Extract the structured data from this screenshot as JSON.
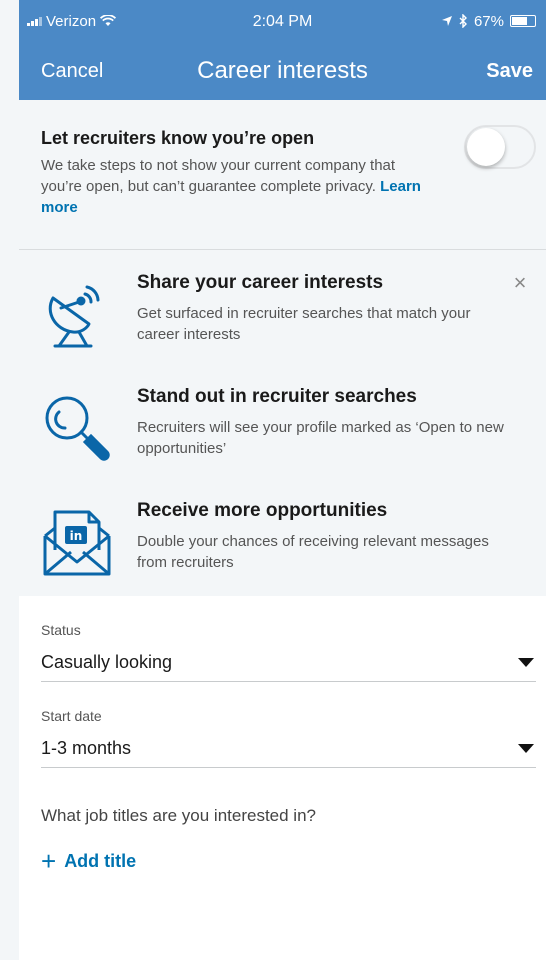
{
  "status_bar": {
    "carrier": "Verizon",
    "time": "2:04 PM",
    "battery": "67%"
  },
  "nav": {
    "cancel_label": "Cancel",
    "title": "Career interests",
    "save_label": "Save"
  },
  "open_to_recruiters": {
    "title": "Let recruiters know you’re open",
    "description": "We take steps to not show your current company that you’re open, but can’t guarantee complete privacy.",
    "learn_more": "Learn more",
    "toggle_on": false
  },
  "benefits": {
    "dismiss_label": "×",
    "items": [
      {
        "icon": "satellite-dish-icon",
        "title": "Share your career interests",
        "description": "Get surfaced in recruiter searches that match your career interests"
      },
      {
        "icon": "magnifier-icon",
        "title": "Stand out in recruiter searches",
        "description": "Recruiters will see your profile marked as ‘Open to new opportunities’"
      },
      {
        "icon": "linkedin-envelope-icon",
        "title": "Receive more opportunities",
        "description": "Double your chances of receiving relevant messages from recruiters"
      }
    ]
  },
  "form": {
    "status": {
      "label": "Status",
      "value": "Casually looking"
    },
    "start_date": {
      "label": "Start date",
      "value": "1-3 months"
    },
    "job_titles": {
      "question": "What job titles are you interested in?",
      "add_label": "Add title",
      "add_icon": "+"
    }
  },
  "colors": {
    "header_blue": "#4b89c6",
    "link_blue": "#0073b1",
    "icon_blue": "#0a66a8",
    "panel_bg": "#f3f6f8"
  }
}
